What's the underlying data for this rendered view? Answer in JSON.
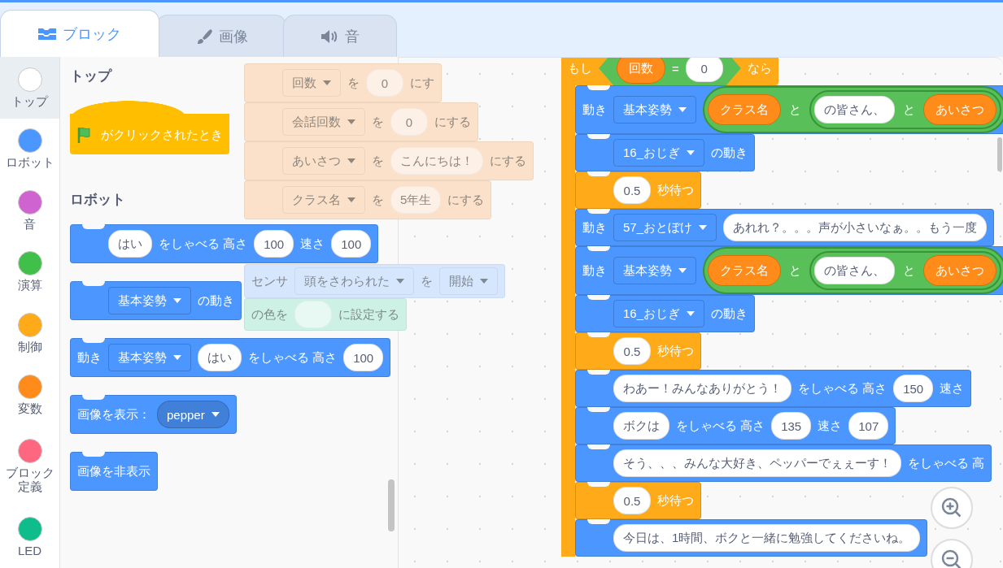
{
  "tabs": [
    {
      "label": "ブロック",
      "selected": true
    },
    {
      "label": "画像",
      "selected": false
    },
    {
      "label": "音",
      "selected": false
    }
  ],
  "categories": [
    {
      "label": "トップ",
      "color": "#ffffff",
      "selected": true
    },
    {
      "label": "ロボット",
      "color": "#4c97ff",
      "selected": false
    },
    {
      "label": "音",
      "color": "#cf63cf",
      "selected": false
    },
    {
      "label": "演算",
      "color": "#40bf4a",
      "selected": false
    },
    {
      "label": "制御",
      "color": "#ffab19",
      "selected": false
    },
    {
      "label": "変数",
      "color": "#ff8c1a",
      "selected": false
    },
    {
      "label": "ブロック定義",
      "color": "#ff6680",
      "selected": false
    },
    {
      "label": "LED",
      "color": "#0fbd8c",
      "selected": false
    }
  ],
  "palette": [
    {
      "kind": "heading",
      "text": "トップ"
    },
    {
      "kind": "hat",
      "color": "#ffbf00",
      "parts": [
        {
          "kind": "flag"
        },
        {
          "kind": "text",
          "text": "がクリックされたとき"
        }
      ]
    },
    {
      "kind": "heading",
      "text": "ロボット"
    },
    {
      "kind": "stack",
      "color": "#4c97ff",
      "parts": [
        {
          "kind": "field",
          "text": "はい"
        },
        {
          "kind": "text",
          "text": "をしゃべる 高さ"
        },
        {
          "kind": "field",
          "text": "100"
        },
        {
          "kind": "text",
          "text": "速さ"
        },
        {
          "kind": "field",
          "text": "100"
        }
      ]
    },
    {
      "kind": "stack",
      "color": "#4c97ff",
      "parts": [
        {
          "kind": "menu",
          "text": "基本姿勢"
        },
        {
          "kind": "text",
          "text": "の動き"
        }
      ]
    },
    {
      "kind": "stack",
      "color": "#4c97ff",
      "parts": [
        {
          "kind": "text",
          "text": "動き"
        },
        {
          "kind": "menu",
          "text": "基本姿勢"
        },
        {
          "kind": "field",
          "text": "はい"
        },
        {
          "kind": "text",
          "text": "をしゃべる 高さ"
        },
        {
          "kind": "field",
          "text": "100"
        }
      ]
    },
    {
      "kind": "stack",
      "color": "#4c97ff",
      "parts": [
        {
          "kind": "text",
          "text": "画像を表示："
        },
        {
          "kind": "round_menu",
          "text": "pepper"
        }
      ]
    },
    {
      "kind": "stack",
      "color": "#4c97ff",
      "parts": [
        {
          "kind": "text",
          "text": "画像を非表示"
        }
      ]
    }
  ],
  "dragged_blocks": [
    {
      "color": "#fbe1c9",
      "parts": [
        {
          "kind": "menu",
          "text": "回数"
        },
        {
          "kind": "text",
          "text": "を"
        },
        {
          "kind": "field",
          "text": "0"
        },
        {
          "kind": "text",
          "text": "にす"
        }
      ]
    },
    {
      "color": "#fbe1c9",
      "parts": [
        {
          "kind": "menu",
          "text": "会話回数"
        },
        {
          "kind": "text",
          "text": "を"
        },
        {
          "kind": "field",
          "text": "0"
        },
        {
          "kind": "text",
          "text": "にする"
        }
      ]
    },
    {
      "color": "#fbe1c9",
      "parts": [
        {
          "kind": "menu",
          "text": "あいさつ"
        },
        {
          "kind": "text",
          "text": "を"
        },
        {
          "kind": "field",
          "text": "こんにちは！"
        },
        {
          "kind": "text",
          "text": "にする"
        }
      ]
    },
    {
      "color": "#fbe1c9",
      "parts": [
        {
          "kind": "menu",
          "text": "クラス名"
        },
        {
          "kind": "text",
          "text": "を"
        },
        {
          "kind": "field",
          "text": "5年生"
        },
        {
          "kind": "text",
          "text": "にする"
        }
      ]
    },
    {
      "color": "#d6e6fd",
      "parts": [
        {
          "kind": "text",
          "text": "センサ"
        },
        {
          "kind": "menu",
          "text": "頭をさわられた"
        },
        {
          "kind": "text",
          "text": "を"
        },
        {
          "kind": "menu",
          "text": "開始"
        }
      ]
    },
    {
      "color": "#cdf1e4",
      "parts": [
        {
          "kind": "text",
          "text": "の色を"
        },
        {
          "kind": "field"
        },
        {
          "kind": "text",
          "text": "に設定する"
        }
      ]
    }
  ],
  "script": {
    "color": "#ffab19",
    "condition": [
      {
        "kind": "text",
        "text": "もし"
      },
      {
        "kind": "boolean",
        "parts": [
          {
            "kind": "reporter",
            "text": "回数"
          },
          {
            "kind": "text",
            "text": "="
          },
          {
            "kind": "field",
            "text": "0"
          }
        ]
      },
      {
        "kind": "text",
        "text": "なら"
      }
    ],
    "blocks": [
      {
        "color": "#4c97ff",
        "parts": [
          {
            "kind": "text",
            "text": "動き"
          },
          {
            "kind": "menu",
            "text": "基本姿勢"
          },
          {
            "kind": "join",
            "parts": [
              {
                "kind": "reporter",
                "text": "クラス名"
              },
              {
                "kind": "text",
                "text": "と"
              },
              {
                "kind": "join",
                "parts": [
                  {
                    "kind": "field",
                    "text": "の皆さん、"
                  },
                  {
                    "kind": "text",
                    "text": "と"
                  },
                  {
                    "kind": "reporter",
                    "text": "あいさつ"
                  }
                ]
              }
            ]
          }
        ]
      },
      {
        "color": "#4c97ff",
        "parts": [
          {
            "kind": "menu",
            "text": "16_おじぎ"
          },
          {
            "kind": "text",
            "text": "の動き"
          }
        ]
      },
      {
        "color": "#ffab19",
        "parts": [
          {
            "kind": "field",
            "text": "0.5"
          },
          {
            "kind": "text",
            "text": "秒待つ"
          }
        ]
      },
      {
        "color": "#4c97ff",
        "parts": [
          {
            "kind": "text",
            "text": "動き"
          },
          {
            "kind": "menu",
            "text": "57_おとぼけ"
          },
          {
            "kind": "field",
            "text": "あれれ？。。。声が小さいなぁ。。もう一度"
          }
        ]
      },
      {
        "color": "#4c97ff",
        "parts": [
          {
            "kind": "text",
            "text": "動き"
          },
          {
            "kind": "menu",
            "text": "基本姿勢"
          },
          {
            "kind": "join",
            "parts": [
              {
                "kind": "reporter",
                "text": "クラス名"
              },
              {
                "kind": "text",
                "text": "と"
              },
              {
                "kind": "join",
                "parts": [
                  {
                    "kind": "field",
                    "text": "の皆さん、"
                  },
                  {
                    "kind": "text",
                    "text": "と"
                  },
                  {
                    "kind": "reporter",
                    "text": "あいさつ"
                  }
                ]
              }
            ]
          }
        ]
      },
      {
        "color": "#4c97ff",
        "parts": [
          {
            "kind": "menu",
            "text": "16_おじぎ"
          },
          {
            "kind": "text",
            "text": "の動き"
          }
        ]
      },
      {
        "color": "#ffab19",
        "parts": [
          {
            "kind": "field",
            "text": "0.5"
          },
          {
            "kind": "text",
            "text": "秒待つ"
          }
        ]
      },
      {
        "color": "#4c97ff",
        "parts": [
          {
            "kind": "field",
            "text": "わあー！みんなありがとう！"
          },
          {
            "kind": "text",
            "text": "をしゃべる 高さ"
          },
          {
            "kind": "field",
            "text": "150"
          },
          {
            "kind": "text",
            "text": "速さ"
          }
        ]
      },
      {
        "color": "#4c97ff",
        "parts": [
          {
            "kind": "field",
            "text": "ボクは"
          },
          {
            "kind": "text",
            "text": "をしゃべる 高さ"
          },
          {
            "kind": "field",
            "text": "135"
          },
          {
            "kind": "text",
            "text": "速さ"
          },
          {
            "kind": "field",
            "text": "107"
          }
        ]
      },
      {
        "color": "#4c97ff",
        "parts": [
          {
            "kind": "field",
            "text": "そう、、、みんな大好き、ペッパーでぇぇーす！"
          },
          {
            "kind": "text",
            "text": "をしゃべる 高"
          }
        ]
      },
      {
        "color": "#ffab19",
        "parts": [
          {
            "kind": "field",
            "text": "0.5"
          },
          {
            "kind": "text",
            "text": "秒待つ"
          }
        ]
      },
      {
        "color": "#4c97ff",
        "parts": [
          {
            "kind": "field",
            "text": "今日は、1時間、ボクと一緒に勉強してくださいね。"
          }
        ]
      }
    ]
  }
}
